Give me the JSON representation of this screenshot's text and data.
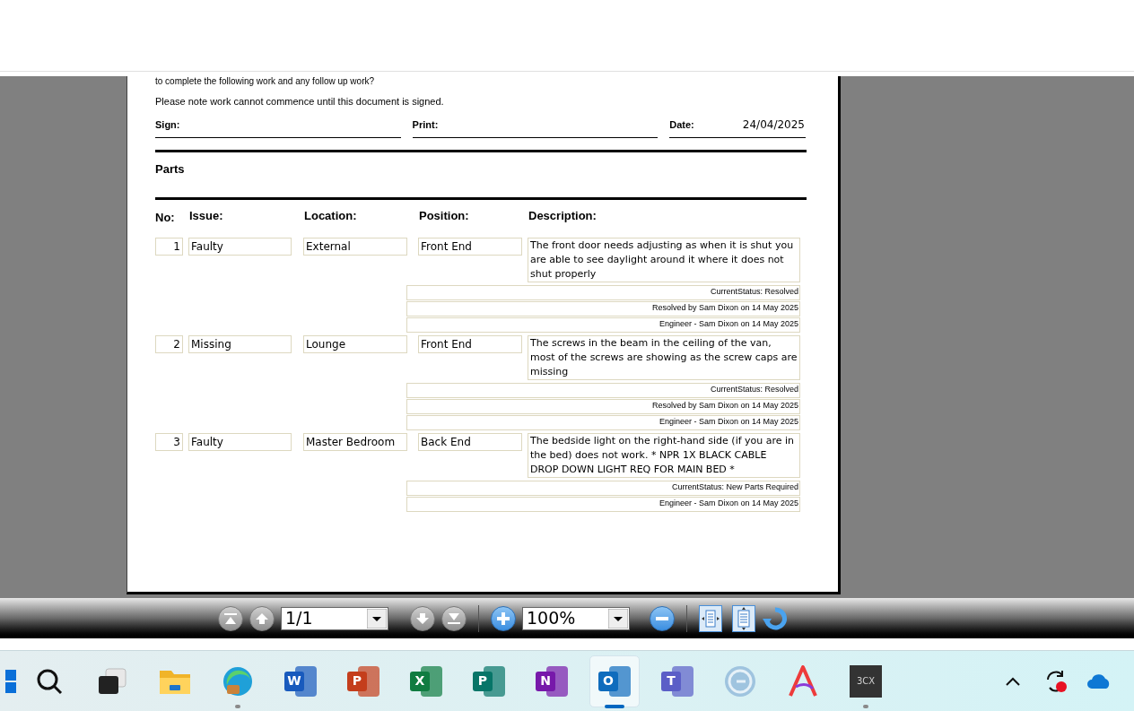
{
  "document": {
    "cut_text": "to complete the following work and any follow up work?",
    "note": "Please note work cannot commence until this document is signed.",
    "sign_fields": [
      {
        "label": "Sign:"
      },
      {
        "label": "Print:"
      },
      {
        "label": "Date:",
        "value": "24/04/2025"
      }
    ],
    "section_title": "Parts",
    "columns": [
      "No:",
      "Issue:",
      "Location:",
      "Position:",
      "Description:"
    ],
    "parts": [
      {
        "no": "1",
        "issue": "Faulty",
        "location": "External",
        "position": "Front End",
        "description": "The front door needs adjusting as when it is shut you are able to see daylight around it where it does not shut properly",
        "notes": [
          "CurrentStatus: Resolved",
          "Resolved by Sam Dixon on 14 May 2025",
          "Engineer - Sam Dixon on 14 May 2025"
        ]
      },
      {
        "no": "2",
        "issue": "Missing",
        "location": "Lounge",
        "position": "Front End",
        "description": "The screws in the beam in the ceiling of the van, most of the screws are showing as the screw caps are missing",
        "notes": [
          "CurrentStatus: Resolved",
          "Resolved by Sam Dixon on 14 May 2025",
          "Engineer - Sam Dixon on 14 May 2025"
        ]
      },
      {
        "no": "3",
        "issue": "Faulty",
        "location": "Master Bedroom",
        "position": "Back End",
        "description": "The bedside light on the right-hand side (if you are in the bed) does not work. * NPR 1X BLACK CABLE DROP DOWN LIGHT REQ FOR MAIN BED *",
        "notes": [
          "CurrentStatus: New Parts Required",
          "Engineer - Sam Dixon on 14 May 2025"
        ]
      }
    ]
  },
  "toolbar": {
    "page": "1/1",
    "zoom": "100%"
  },
  "taskbar": {
    "apps": [
      {
        "kind": "start",
        "running": false,
        "active": false
      },
      {
        "kind": "search",
        "running": false,
        "active": false
      },
      {
        "kind": "taskview",
        "running": false,
        "active": false
      },
      {
        "kind": "folder",
        "running": false,
        "active": false
      },
      {
        "kind": "browser",
        "running": true,
        "active": false
      },
      {
        "kind": "letter",
        "letter": "W",
        "color": "#185abd",
        "running": false,
        "active": false
      },
      {
        "kind": "letter",
        "letter": "P",
        "color": "#c43e1c",
        "running": false,
        "active": false
      },
      {
        "kind": "letter",
        "letter": "X",
        "color": "#107c41",
        "running": false,
        "active": false
      },
      {
        "kind": "letter",
        "letter": "P",
        "color": "#077568",
        "running": false,
        "active": false
      },
      {
        "kind": "letter",
        "letter": "N",
        "color": "#7719aa",
        "running": false,
        "active": false
      },
      {
        "kind": "letter",
        "letter": "O",
        "color": "#0f6cbd",
        "running": false,
        "active": true
      },
      {
        "kind": "letter",
        "letter": "T",
        "color": "#5b5fc7",
        "running": false,
        "active": false
      },
      {
        "kind": "disc",
        "running": false,
        "active": false
      },
      {
        "kind": "a-logo",
        "running": false,
        "active": false
      },
      {
        "kind": "label",
        "letter": "3CX",
        "color": "#333333",
        "running": true,
        "active": false
      }
    ]
  }
}
